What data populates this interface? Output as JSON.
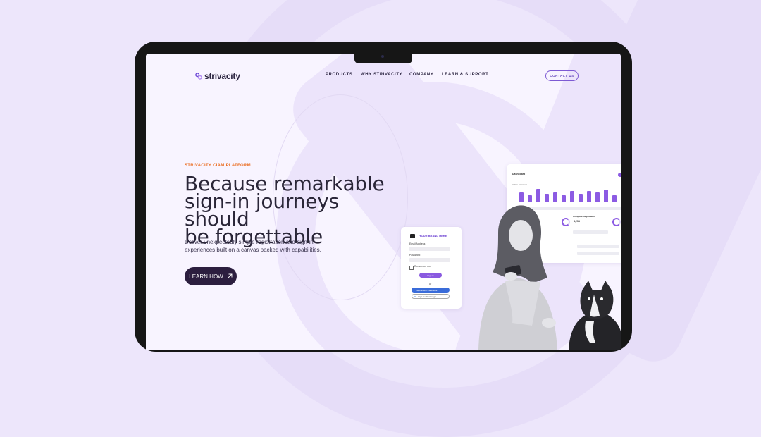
{
  "nav": {
    "logo_text": "strivacity",
    "items": [
      "PRODUCTS",
      "WHY STRIVACITY",
      "COMPANY",
      "LEARN & SUPPORT"
    ],
    "contact_label": "CONTACT US"
  },
  "hero": {
    "eyebrow": "STRIVACITY CIAM PLATFORM",
    "headline_lines": [
      "Because remarkable",
      "sign-in journeys should",
      "be forgettable"
    ],
    "sub_lines": [
      "Deliver unexpectedly simple registration and sign-in",
      "experiences built on a canvas packed with capabilities."
    ],
    "cta_label": "LEARN HOW",
    "cta_icon": "arrow-up-right-icon"
  },
  "signin_card": {
    "brand": "YOUR BRAND HERE",
    "email_label": "Email Address",
    "password_label": "Password",
    "remember_label": "Remember me",
    "signin_button": "Sign in",
    "or_text": "or",
    "facebook_button": "Sign in with Facebook",
    "google_button": "Sign in with Google"
  },
  "dashboard": {
    "title": "Dashboard",
    "subtitle": "Active Accounts",
    "section": "Complete Registration",
    "stat": "3,294"
  },
  "colors": {
    "accent": "#7d5ad3",
    "eyebrow": "#ea6a1c",
    "cta_bg": "#2c1e3f",
    "page_bg": "#ede6fb"
  }
}
